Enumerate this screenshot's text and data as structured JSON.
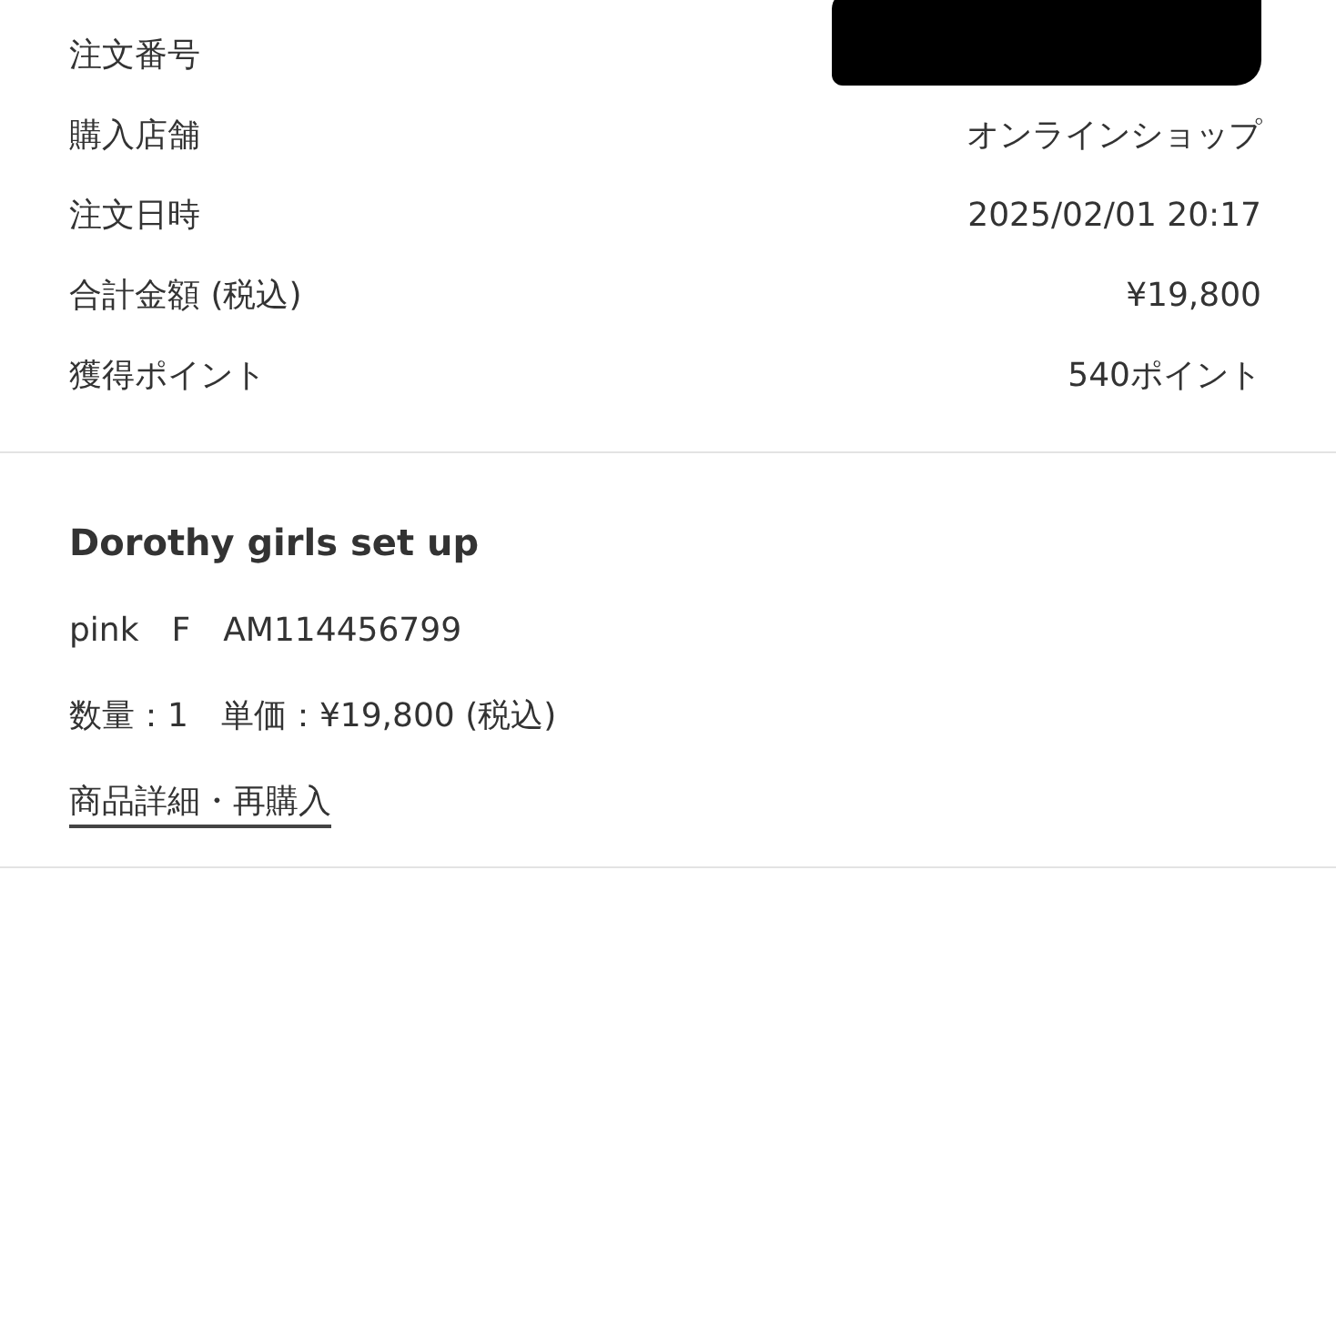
{
  "order_info": [
    {
      "label": "注文番号",
      "redacted": true
    },
    {
      "label": "購入店舗",
      "value": "オンラインショップ"
    },
    {
      "label": "注文日時",
      "value": "2025/02/01 20:17"
    },
    {
      "label": "合計金額 (税込)",
      "value": "¥19,800"
    },
    {
      "label": "獲得ポイント",
      "value": "540ポイント"
    }
  ],
  "item": {
    "name": "Dorothy girls set up",
    "variant": "pink　F　AM114456799",
    "price_line": "数量：1　単価：¥19,800 (税込)",
    "link": "商品詳細・再購入"
  }
}
